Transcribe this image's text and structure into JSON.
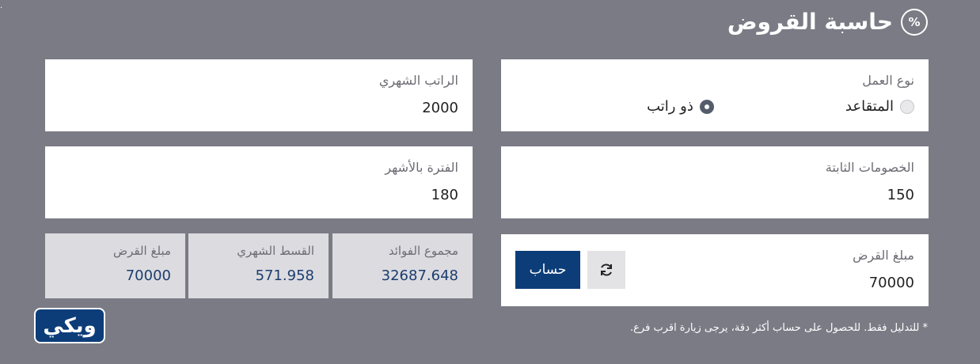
{
  "header": {
    "title": "حاسبة القروض",
    "icon": "percent-icon",
    "icon_glyph": "%"
  },
  "fields": {
    "work_type": {
      "label": "نوع العمل",
      "options": [
        {
          "label": "المتقاعد",
          "selected": false
        },
        {
          "label": "ذو راتب",
          "selected": true
        }
      ]
    },
    "salary": {
      "label": "الراتب الشهري",
      "value": "2000"
    },
    "deductions": {
      "label": "الخصومات الثابتة",
      "value": "150"
    },
    "period": {
      "label": "الفترة بالأشهر",
      "value": "180"
    },
    "loan_amount": {
      "label": "مبلغ القرض",
      "value": "70000"
    }
  },
  "actions": {
    "calculate_label": "حساب",
    "reset_icon": "refresh-icon"
  },
  "results": [
    {
      "label": "مجموع الفوائد",
      "value": "32687.648"
    },
    {
      "label": "القسط الشهري",
      "value": "571.958"
    },
    {
      "label": "مبلغ القرض",
      "value": "70000"
    }
  ],
  "note": "* للتدليل فقط. للحصول على حساب أكثر دقة، يرجى زيارة اقرب فرع.",
  "logo": {
    "text": "ويكي"
  },
  "colors": {
    "background": "#7b7b86",
    "primary": "#0c3d78",
    "result_value": "#1c3d6e",
    "result_bg": "#dcdce0"
  }
}
